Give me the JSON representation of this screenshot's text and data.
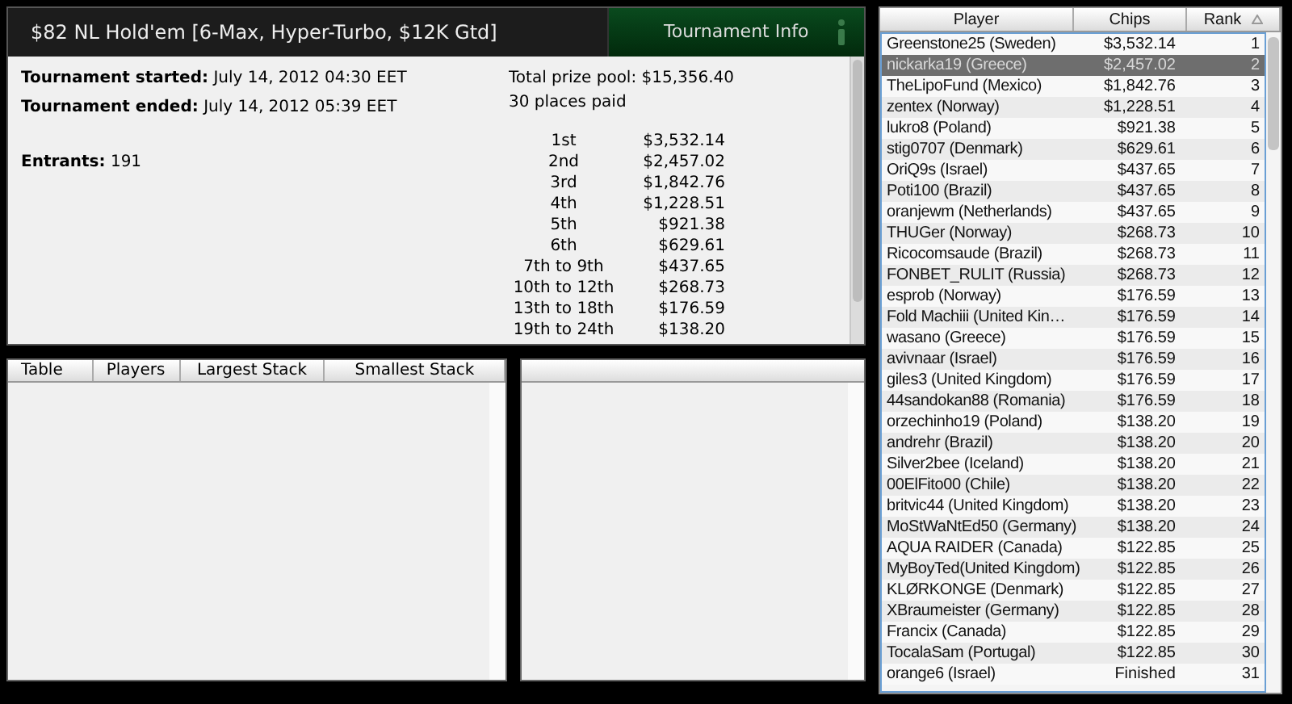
{
  "header": {
    "title": "$82 NL Hold'em [6-Max, Hyper-Turbo, $12K Gtd]",
    "info_tab": {
      "label": "Tournament Info",
      "selected": true
    }
  },
  "info": {
    "started_label": "Tournament started:",
    "started_value": "July 14, 2012 04:30 EET",
    "ended_label": "Tournament ended:",
    "ended_value": "July 14, 2012 05:39 EET",
    "entrants_label": "Entrants:",
    "entrants_value": "191",
    "prize_pool": "Total prize pool: $15,356.40",
    "places_paid": "30 places paid",
    "payouts": [
      {
        "place": "1st",
        "amount": "$3,532.14"
      },
      {
        "place": "2nd",
        "amount": "$2,457.02"
      },
      {
        "place": "3rd",
        "amount": "$1,842.76"
      },
      {
        "place": "4th",
        "amount": "$1,228.51"
      },
      {
        "place": "5th",
        "amount": "$921.38"
      },
      {
        "place": "6th",
        "amount": "$629.61"
      },
      {
        "place": "7th to 9th",
        "amount": "$437.65"
      },
      {
        "place": "10th to 12th",
        "amount": "$268.73"
      },
      {
        "place": "13th to 18th",
        "amount": "$176.59"
      },
      {
        "place": "19th to 24th",
        "amount": "$138.20"
      }
    ]
  },
  "tables": {
    "columns": [
      "Table",
      "Players",
      "Largest Stack",
      "Smallest Stack"
    ]
  },
  "players": {
    "columns": [
      {
        "label": "Player",
        "sorted": false
      },
      {
        "label": "Chips",
        "sorted": false
      },
      {
        "label": "Rank",
        "sorted": true
      }
    ],
    "rows": [
      {
        "player": "Greenstone25 (Sweden)",
        "chips": "$3,532.14",
        "rank": "1",
        "selected": false
      },
      {
        "player": "nickarka19 (Greece)",
        "chips": "$2,457.02",
        "rank": "2",
        "selected": true
      },
      {
        "player": "TheLipoFund (Mexico)",
        "chips": "$1,842.76",
        "rank": "3",
        "selected": false
      },
      {
        "player": "zentex (Norway)",
        "chips": "$1,228.51",
        "rank": "4",
        "selected": false
      },
      {
        "player": "lukro8 (Poland)",
        "chips": "$921.38",
        "rank": "5",
        "selected": false
      },
      {
        "player": "stig0707 (Denmark)",
        "chips": "$629.61",
        "rank": "6",
        "selected": false
      },
      {
        "player": "OriQ9s (Israel)",
        "chips": "$437.65",
        "rank": "7",
        "selected": false
      },
      {
        "player": "Poti100 (Brazil)",
        "chips": "$437.65",
        "rank": "8",
        "selected": false
      },
      {
        "player": "oranjewm (Netherlands)",
        "chips": "$437.65",
        "rank": "9",
        "selected": false
      },
      {
        "player": "THUGer (Norway)",
        "chips": "$268.73",
        "rank": "10",
        "selected": false
      },
      {
        "player": "Ricocomsaude (Brazil)",
        "chips": "$268.73",
        "rank": "11",
        "selected": false
      },
      {
        "player": "FONBET_RULIT (Russia)",
        "chips": "$268.73",
        "rank": "12",
        "selected": false
      },
      {
        "player": "esprob (Norway)",
        "chips": "$176.59",
        "rank": "13",
        "selected": false
      },
      {
        "player": "Fold Machiii (United Kin…",
        "chips": "$176.59",
        "rank": "14",
        "selected": false
      },
      {
        "player": "wasano (Greece)",
        "chips": "$176.59",
        "rank": "15",
        "selected": false
      },
      {
        "player": "avivnaar (Israel)",
        "chips": "$176.59",
        "rank": "16",
        "selected": false
      },
      {
        "player": "giles3 (United Kingdom)",
        "chips": "$176.59",
        "rank": "17",
        "selected": false
      },
      {
        "player": "44sandokan88 (Romania)",
        "chips": "$176.59",
        "rank": "18",
        "selected": false
      },
      {
        "player": "orzechinho19 (Poland)",
        "chips": "$138.20",
        "rank": "19",
        "selected": false
      },
      {
        "player": "andrehr (Brazil)",
        "chips": "$138.20",
        "rank": "20",
        "selected": false
      },
      {
        "player": "Silver2bee (Iceland)",
        "chips": "$138.20",
        "rank": "21",
        "selected": false
      },
      {
        "player": "00ElFito00 (Chile)",
        "chips": "$138.20",
        "rank": "22",
        "selected": false
      },
      {
        "player": "britvic44 (United Kingdom)",
        "chips": "$138.20",
        "rank": "23",
        "selected": false
      },
      {
        "player": "MoStWaNtEd50 (Germany)",
        "chips": "$138.20",
        "rank": "24",
        "selected": false
      },
      {
        "player": "AQUA RAIDER (Canada)",
        "chips": "$122.85",
        "rank": "25",
        "selected": false
      },
      {
        "player": "MyBoyTed(United Kingdom)",
        "chips": "$122.85",
        "rank": "26",
        "selected": false
      },
      {
        "player": "KLØRKONGE (Denmark)",
        "chips": "$122.85",
        "rank": "27",
        "selected": false
      },
      {
        "player": "XBraumeister (Germany)",
        "chips": "$122.85",
        "rank": "28",
        "selected": false
      },
      {
        "player": "Francix (Canada)",
        "chips": "$122.85",
        "rank": "29",
        "selected": false
      },
      {
        "player": "TocalaSam (Portugal)",
        "chips": "$122.85",
        "rank": "30",
        "selected": false
      },
      {
        "player": "orange6 (Israel)",
        "chips": "Finished",
        "rank": "31",
        "selected": false
      }
    ]
  }
}
